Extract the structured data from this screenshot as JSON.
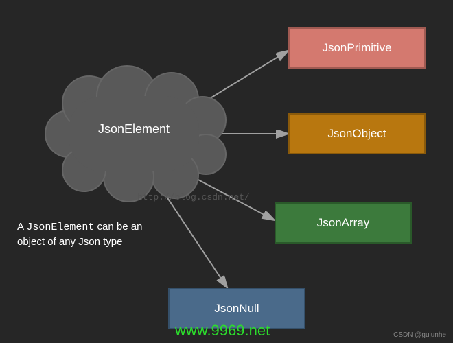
{
  "chart_data": {
    "type": "diagram",
    "title": "",
    "root": {
      "label": "JsonElement",
      "shape": "cloud"
    },
    "children": [
      {
        "label": "JsonPrimitive",
        "color": "#d4796f"
      },
      {
        "label": "JsonObject",
        "color": "#b8770f"
      },
      {
        "label": "JsonArray",
        "color": "#3c7a3c"
      },
      {
        "label": "JsonNull",
        "color": "#4a6a8a"
      }
    ],
    "edges": [
      [
        "JsonElement",
        "JsonPrimitive"
      ],
      [
        "JsonElement",
        "JsonObject"
      ],
      [
        "JsonElement",
        "JsonArray"
      ],
      [
        "JsonElement",
        "JsonNull"
      ]
    ]
  },
  "caption": {
    "prefix": "A ",
    "mono": "JsonElement",
    "suffix": " can be an object of any Json type"
  },
  "watermarks": {
    "csdn": "http://blog.csdn.net/",
    "credit": "CSDN @gujunhe",
    "green": "www.9969.net"
  },
  "cloud_label": "JsonElement",
  "box_labels": {
    "primitive": "JsonPrimitive",
    "object": "JsonObject",
    "array": "JsonArray",
    "null": "JsonNull"
  }
}
